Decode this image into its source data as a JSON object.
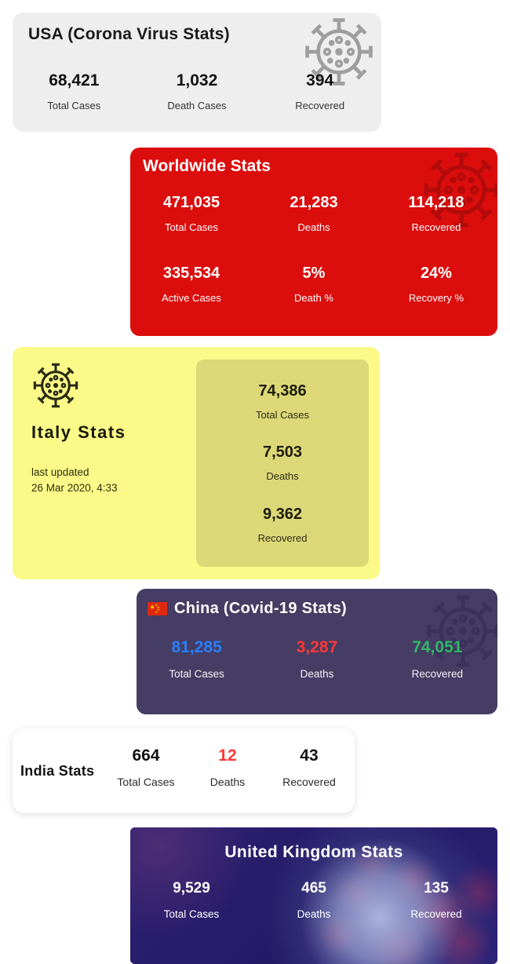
{
  "usa": {
    "title": "USA (Corona Virus Stats)",
    "icon": "coronavirus-icon",
    "stats": [
      {
        "value": "68,421",
        "label": "Total Cases"
      },
      {
        "value": "1,032",
        "label": "Death Cases"
      },
      {
        "value": "394",
        "label": "Recovered"
      }
    ],
    "bg_color": "#eeeeee",
    "icon_color": "#9e9e9e"
  },
  "worldwide": {
    "title": "Worldwide Stats",
    "icon": "coronavirus-icon",
    "stats_row1": [
      {
        "value": "471,035",
        "label": "Total Cases"
      },
      {
        "value": "21,283",
        "label": "Deaths"
      },
      {
        "value": "114,218",
        "label": "Recovered"
      }
    ],
    "stats_row2": [
      {
        "value": "335,534",
        "label": "Active Cases"
      },
      {
        "value": "5%",
        "label": "Death %"
      },
      {
        "value": "24%",
        "label": "Recovery %"
      }
    ],
    "bg_color": "#dc0d0d",
    "icon_color": "#b30b0b"
  },
  "italy": {
    "title": "Italy Stats",
    "icon": "coronavirus-icon",
    "updated_label": "last updated",
    "updated_value": "26 Mar 2020, 4:33",
    "stats": [
      {
        "value": "74,386",
        "label": "Total Cases"
      },
      {
        "value": "7,503",
        "label": "Deaths"
      },
      {
        "value": "9,362",
        "label": "Recovered"
      }
    ],
    "bg_color": "#fbfa88",
    "panel_color": "#dcd878"
  },
  "china": {
    "title": "China (Covid-19 Stats)",
    "flag": "china-flag-icon",
    "icon": "coronavirus-icon",
    "stats": [
      {
        "value": "81,285",
        "label": "Total Cases",
        "color": "#2a7fff"
      },
      {
        "value": "3,287",
        "label": "Deaths",
        "color": "#ff3838"
      },
      {
        "value": "74,051",
        "label": "Recovered",
        "color": "#2fb866"
      }
    ],
    "bg_color": "#453d63",
    "icon_color": "#39325a"
  },
  "india": {
    "title": "India Stats",
    "stats": [
      {
        "value": "664",
        "label": "Total Cases",
        "color": "#111111"
      },
      {
        "value": "12",
        "label": "Deaths",
        "color": "#ff3838"
      },
      {
        "value": "43",
        "label": "Recovered",
        "color": "#111111"
      }
    ],
    "bg_color": "#ffffff"
  },
  "uk": {
    "title": "United Kingdom Stats",
    "stats": [
      {
        "value": "9,529",
        "label": "Total Cases"
      },
      {
        "value": "465",
        "label": "Deaths"
      },
      {
        "value": "135",
        "label": "Recovered"
      }
    ],
    "bg_color": "#2a2070"
  }
}
